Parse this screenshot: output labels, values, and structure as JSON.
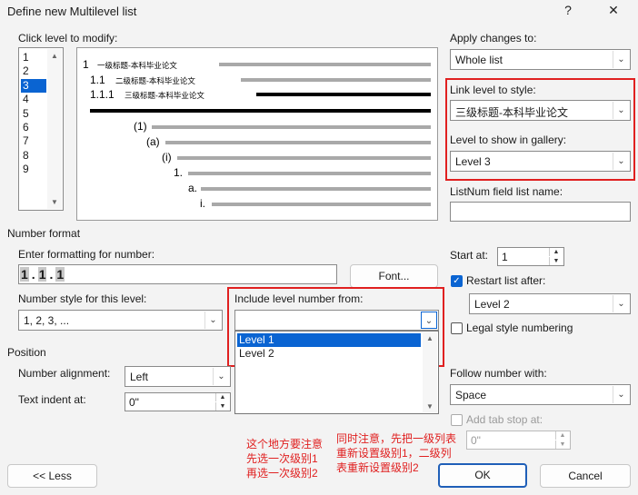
{
  "window": {
    "title": "Define new Multilevel list",
    "help_label": "?",
    "close_label": "✕"
  },
  "click_level": {
    "label": "Click level to modify:",
    "levels": [
      "1",
      "2",
      "3",
      "4",
      "5",
      "6",
      "7",
      "8",
      "9"
    ],
    "selected_index": 2,
    "scroll_up": "▲",
    "scroll_down": "▼"
  },
  "preview": {
    "rows": [
      {
        "num": "1",
        "title": "一级标题-本科毕业论文"
      },
      {
        "num": "1.1",
        "title": "二级标题-本科毕业论文"
      },
      {
        "num": "1.1.1",
        "title": "三级标题-本科毕业论文"
      }
    ],
    "sub_labels": [
      "(1)",
      "(a)",
      "(i)",
      "1.",
      "a.",
      "i."
    ]
  },
  "apply_changes": {
    "label": "Apply changes to:",
    "value": "Whole list"
  },
  "link_level": {
    "label": "Link level to style:",
    "value": "三级标题-本科毕业论文"
  },
  "gallery_level": {
    "label": "Level to show in gallery:",
    "value": "Level 3"
  },
  "listnum": {
    "label": "ListNum field list name:",
    "value": ""
  },
  "number_format": {
    "section_label": "Number format",
    "enter_label": "Enter formatting for number:",
    "format_parts": [
      "1",
      ".",
      "1",
      ".",
      "1"
    ],
    "font_button": "Font...",
    "style_label": "Number style for this level:",
    "style_value": "1, 2, 3, ...",
    "include_label": "Include level number from:",
    "include_value": "",
    "include_options": [
      "Level 1",
      "Level 2"
    ],
    "include_selected_index": 0
  },
  "start_at": {
    "label": "Start at:",
    "value": "1"
  },
  "restart": {
    "label": "Restart list after:",
    "checked": true,
    "value": "Level 2"
  },
  "legal": {
    "label": "Legal style numbering",
    "checked": false
  },
  "position": {
    "section_label": "Position",
    "alignment_label": "Number alignment:",
    "alignment_value": "Left",
    "indent_label": "Text indent at:",
    "indent_value": "0\""
  },
  "follow": {
    "label": "Follow number with:",
    "value": "Space",
    "tab_label": "Add tab stop at:",
    "tab_value": "0\""
  },
  "annotations": {
    "left": "这个地方要注意\n先选一次级别1\n再选一次级别2",
    "right": "同时注意，先把一级列表\n重新设置级别1，二级列\n表重新设置级别2"
  },
  "buttons": {
    "less": "<< Less",
    "ok": "OK",
    "cancel": "Cancel"
  },
  "colors": {
    "accent": "#0a64d2",
    "annotation": "#e02020"
  }
}
